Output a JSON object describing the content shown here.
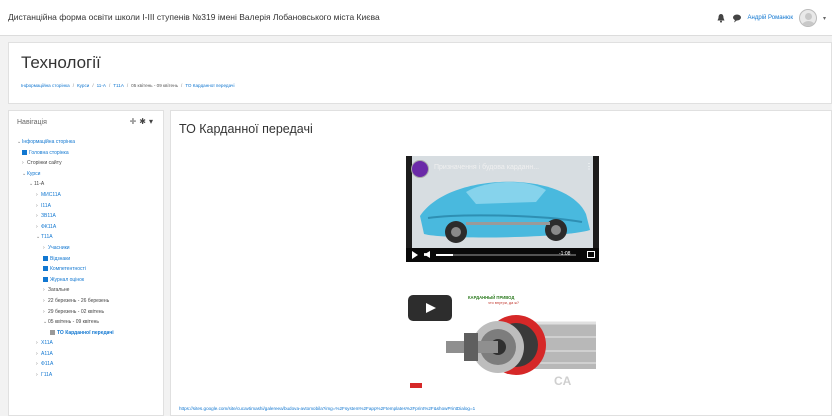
{
  "topbar": {
    "site_name": "Дистанційна форма освіти школи І-ІІІ ступенів №319 імені Валерія Лобановського міста Києва",
    "user_name": "Андрій Романюк",
    "caret": "▾"
  },
  "page_header": {
    "heading": "Технології",
    "breadcrumbs": [
      "Інформаційна сторінка",
      "Курси",
      "11-А",
      "Т11А",
      "05 квітень - 09 квітень",
      "ТО Карданної передачі"
    ],
    "separator": "/"
  },
  "navigation": {
    "title": "Навігація",
    "add": "✛",
    "gear": "✱",
    "caret": "▾",
    "items": [
      {
        "text": "Інформаційна сторінка",
        "tw": "⌄"
      },
      {
        "text": "Головна сторінка",
        "tw": ""
      },
      {
        "text": "Сторінки сайту",
        "tw": "›"
      },
      {
        "text": "Курси",
        "tw": "⌄"
      },
      {
        "text": "11-А",
        "tw": "⌄"
      },
      {
        "text": "МИС11А",
        "tw": "›"
      },
      {
        "text": "І11А",
        "tw": "›"
      },
      {
        "text": "ЗВ11А",
        "tw": "›"
      },
      {
        "text": "ФК11А",
        "tw": "›"
      },
      {
        "text": "Т11А",
        "tw": "⌄"
      },
      {
        "text": "Учасники",
        "tw": "›"
      },
      {
        "text": "Відзнаки",
        "tw": ""
      },
      {
        "text": "Компетентності",
        "tw": ""
      },
      {
        "text": "Журнал оцінок",
        "tw": ""
      },
      {
        "text": "Загальне",
        "tw": "›"
      },
      {
        "text": "22 березень - 26 березень",
        "tw": "›"
      },
      {
        "text": "29 березень - 02 квітень",
        "tw": "›"
      },
      {
        "text": "05 квітень - 09 квітень",
        "tw": "⌄"
      },
      {
        "text": "ТО Карданної передачі",
        "tw": ""
      },
      {
        "text": "Х11А",
        "tw": "›"
      },
      {
        "text": "А11А",
        "tw": "›"
      },
      {
        "text": "Ф11А",
        "tw": "›"
      },
      {
        "text": "Г11А",
        "tw": "›"
      }
    ]
  },
  "content": {
    "title": "ТО Карданної передачі",
    "video": {
      "title": "Призначення і будова карданн...",
      "more": "⋮",
      "time": "-1:08",
      "progress": 0.12
    },
    "gif": {
      "label": "КАРДАННЫЙ ПРИВОД",
      "sub": "что внутри, да ж?"
    },
    "url": "https://sites.google.com/site/cucavtimashi/galereea/budova-avtomobila?img=%2Fsystem%2Fapp%2Ftemplates%2Fprint%2F&showPrintDialog=1"
  },
  "colors": {
    "link": "#1177d1",
    "page_bg": "#f2f2f2",
    "card_bg": "#ffffff"
  }
}
